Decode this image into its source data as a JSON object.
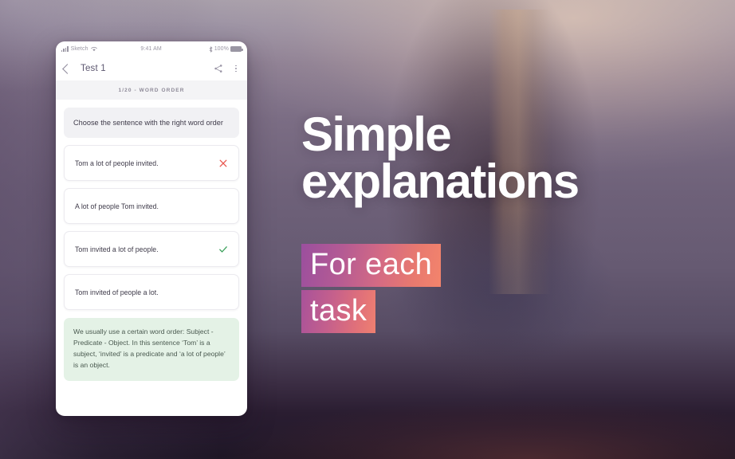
{
  "phone": {
    "status_bar": {
      "signal_icon": "signal-bars-icon",
      "carrier": "Sketch",
      "wifi_icon": "wifi-icon",
      "time": "9:41 AM",
      "bluetooth_icon": "bluetooth-icon",
      "battery_percent": "100%",
      "battery_icon": "battery-full-icon"
    },
    "app_bar": {
      "back_icon": "back-chevron-icon",
      "title": "Test 1",
      "share_icon": "share-icon",
      "overflow_icon": "overflow-menu-icon"
    },
    "section": {
      "label": "1/20 - WORD ORDER"
    },
    "question": {
      "prompt": "Choose the sentence with the right word order"
    },
    "options": [
      {
        "text": "Tom a lot of people invited.",
        "mark": "cross-icon",
        "state": "incorrect"
      },
      {
        "text": "A lot of people Tom invited.",
        "mark": "none",
        "state": "neutral"
      },
      {
        "text": "Tom invited a lot of people.",
        "mark": "check-icon",
        "state": "correct"
      },
      {
        "text": "Tom invited of people a lot.",
        "mark": "none",
        "state": "neutral"
      }
    ],
    "explanation": {
      "text": "We usually use a certain word order: Subject - Predicate - Object. In this sentence ‘Tom’ is a subject, ‘invited’ is a predicate and ‘a lot of people’ is an object."
    }
  },
  "copy": {
    "headline_line1": "Simple",
    "headline_line2": "explanations",
    "sub_line1": "For each",
    "sub_line2": "task"
  },
  "colors": {
    "correct_green": "#3aa05a",
    "incorrect_red": "#e8564e",
    "explanation_bg": "#e4f2e6",
    "gradient_start": "#9b4f9e",
    "gradient_end": "#f3846c",
    "card_bg": "#ffffff",
    "question_bg": "#f1f1f4"
  }
}
